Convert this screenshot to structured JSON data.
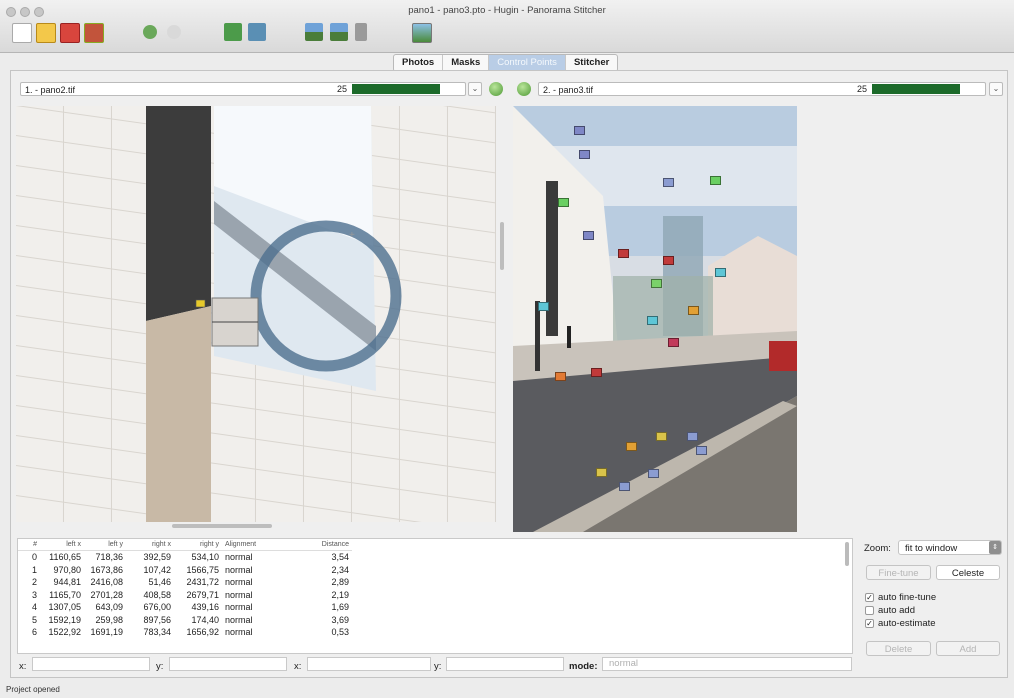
{
  "window": {
    "title": "pano1 - pano3.pto - Hugin - Panorama Stitcher"
  },
  "toolbar": {
    "icons": [
      "new-project-icon",
      "open-project-icon",
      "save-icon",
      "save-as-icon",
      "undo-icon",
      "redo-icon",
      "assistant-icon",
      "images-icon",
      "preview-icon",
      "fast-preview-icon",
      "layout-icon",
      "optimize-icon"
    ]
  },
  "tabs": [
    "Photos",
    "Masks",
    "Control Points",
    "Stitcher"
  ],
  "active_tab": "Control Points",
  "left_image": {
    "label": "1. - pano2.tif",
    "count": "25"
  },
  "right_image": {
    "label": "2. - pano3.tif",
    "count": "25"
  },
  "table": {
    "headers": [
      "#",
      "left x",
      "left y",
      "right x",
      "right y",
      "Alignment",
      "Distance"
    ],
    "rows": [
      [
        "0",
        "1160,65",
        "718,36",
        "392,59",
        "534,10",
        "normal",
        "3,54"
      ],
      [
        "1",
        "970,80",
        "1673,86",
        "107,42",
        "1566,75",
        "normal",
        "2,34"
      ],
      [
        "2",
        "944,81",
        "2416,08",
        "51,46",
        "2431,72",
        "normal",
        "2,89"
      ],
      [
        "3",
        "1165,70",
        "2701,28",
        "408,58",
        "2679,71",
        "normal",
        "2,19"
      ],
      [
        "4",
        "1307,05",
        "643,09",
        "676,00",
        "439,16",
        "normal",
        "1,69"
      ],
      [
        "5",
        "1592,19",
        "259,98",
        "897,56",
        "174,40",
        "normal",
        "3,69"
      ],
      [
        "6",
        "1522,92",
        "1691,19",
        "783,34",
        "1656,92",
        "normal",
        "0,53"
      ]
    ]
  },
  "controls": {
    "zoom_label": "Zoom:",
    "zoom_value": "fit to window",
    "finetune_label": "Fine-tune",
    "delete_top_label": "Celeste",
    "auto_finetune": "auto fine-tune",
    "auto_add": "auto add",
    "auto_estimate": "auto-estimate",
    "delete_label": "Delete",
    "add_label": "Add"
  },
  "coords": {
    "x1_label": "x:",
    "y1_label": "y:",
    "x2_label": "x:",
    "y2_label": "y:",
    "mode_label": "mode:",
    "mode_value": "normal"
  },
  "status": "Project opened",
  "colors": {
    "progress": "#1c6a2a",
    "active_tab": "#b9cde6"
  }
}
